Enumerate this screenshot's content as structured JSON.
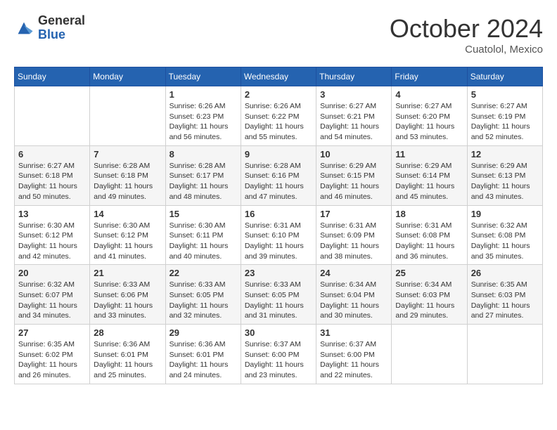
{
  "logo": {
    "general": "General",
    "blue": "Blue"
  },
  "header": {
    "month": "October 2024",
    "location": "Cuatolol, Mexico"
  },
  "weekdays": [
    "Sunday",
    "Monday",
    "Tuesday",
    "Wednesday",
    "Thursday",
    "Friday",
    "Saturday"
  ],
  "weeks": [
    [
      {
        "day": "",
        "info": ""
      },
      {
        "day": "",
        "info": ""
      },
      {
        "day": "1",
        "info": "Sunrise: 6:26 AM\nSunset: 6:23 PM\nDaylight: 11 hours and 56 minutes."
      },
      {
        "day": "2",
        "info": "Sunrise: 6:26 AM\nSunset: 6:22 PM\nDaylight: 11 hours and 55 minutes."
      },
      {
        "day": "3",
        "info": "Sunrise: 6:27 AM\nSunset: 6:21 PM\nDaylight: 11 hours and 54 minutes."
      },
      {
        "day": "4",
        "info": "Sunrise: 6:27 AM\nSunset: 6:20 PM\nDaylight: 11 hours and 53 minutes."
      },
      {
        "day": "5",
        "info": "Sunrise: 6:27 AM\nSunset: 6:19 PM\nDaylight: 11 hours and 52 minutes."
      }
    ],
    [
      {
        "day": "6",
        "info": "Sunrise: 6:27 AM\nSunset: 6:18 PM\nDaylight: 11 hours and 50 minutes."
      },
      {
        "day": "7",
        "info": "Sunrise: 6:28 AM\nSunset: 6:18 PM\nDaylight: 11 hours and 49 minutes."
      },
      {
        "day": "8",
        "info": "Sunrise: 6:28 AM\nSunset: 6:17 PM\nDaylight: 11 hours and 48 minutes."
      },
      {
        "day": "9",
        "info": "Sunrise: 6:28 AM\nSunset: 6:16 PM\nDaylight: 11 hours and 47 minutes."
      },
      {
        "day": "10",
        "info": "Sunrise: 6:29 AM\nSunset: 6:15 PM\nDaylight: 11 hours and 46 minutes."
      },
      {
        "day": "11",
        "info": "Sunrise: 6:29 AM\nSunset: 6:14 PM\nDaylight: 11 hours and 45 minutes."
      },
      {
        "day": "12",
        "info": "Sunrise: 6:29 AM\nSunset: 6:13 PM\nDaylight: 11 hours and 43 minutes."
      }
    ],
    [
      {
        "day": "13",
        "info": "Sunrise: 6:30 AM\nSunset: 6:12 PM\nDaylight: 11 hours and 42 minutes."
      },
      {
        "day": "14",
        "info": "Sunrise: 6:30 AM\nSunset: 6:12 PM\nDaylight: 11 hours and 41 minutes."
      },
      {
        "day": "15",
        "info": "Sunrise: 6:30 AM\nSunset: 6:11 PM\nDaylight: 11 hours and 40 minutes."
      },
      {
        "day": "16",
        "info": "Sunrise: 6:31 AM\nSunset: 6:10 PM\nDaylight: 11 hours and 39 minutes."
      },
      {
        "day": "17",
        "info": "Sunrise: 6:31 AM\nSunset: 6:09 PM\nDaylight: 11 hours and 38 minutes."
      },
      {
        "day": "18",
        "info": "Sunrise: 6:31 AM\nSunset: 6:08 PM\nDaylight: 11 hours and 36 minutes."
      },
      {
        "day": "19",
        "info": "Sunrise: 6:32 AM\nSunset: 6:08 PM\nDaylight: 11 hours and 35 minutes."
      }
    ],
    [
      {
        "day": "20",
        "info": "Sunrise: 6:32 AM\nSunset: 6:07 PM\nDaylight: 11 hours and 34 minutes."
      },
      {
        "day": "21",
        "info": "Sunrise: 6:33 AM\nSunset: 6:06 PM\nDaylight: 11 hours and 33 minutes."
      },
      {
        "day": "22",
        "info": "Sunrise: 6:33 AM\nSunset: 6:05 PM\nDaylight: 11 hours and 32 minutes."
      },
      {
        "day": "23",
        "info": "Sunrise: 6:33 AM\nSunset: 6:05 PM\nDaylight: 11 hours and 31 minutes."
      },
      {
        "day": "24",
        "info": "Sunrise: 6:34 AM\nSunset: 6:04 PM\nDaylight: 11 hours and 30 minutes."
      },
      {
        "day": "25",
        "info": "Sunrise: 6:34 AM\nSunset: 6:03 PM\nDaylight: 11 hours and 29 minutes."
      },
      {
        "day": "26",
        "info": "Sunrise: 6:35 AM\nSunset: 6:03 PM\nDaylight: 11 hours and 27 minutes."
      }
    ],
    [
      {
        "day": "27",
        "info": "Sunrise: 6:35 AM\nSunset: 6:02 PM\nDaylight: 11 hours and 26 minutes."
      },
      {
        "day": "28",
        "info": "Sunrise: 6:36 AM\nSunset: 6:01 PM\nDaylight: 11 hours and 25 minutes."
      },
      {
        "day": "29",
        "info": "Sunrise: 6:36 AM\nSunset: 6:01 PM\nDaylight: 11 hours and 24 minutes."
      },
      {
        "day": "30",
        "info": "Sunrise: 6:37 AM\nSunset: 6:00 PM\nDaylight: 11 hours and 23 minutes."
      },
      {
        "day": "31",
        "info": "Sunrise: 6:37 AM\nSunset: 6:00 PM\nDaylight: 11 hours and 22 minutes."
      },
      {
        "day": "",
        "info": ""
      },
      {
        "day": "",
        "info": ""
      }
    ]
  ]
}
